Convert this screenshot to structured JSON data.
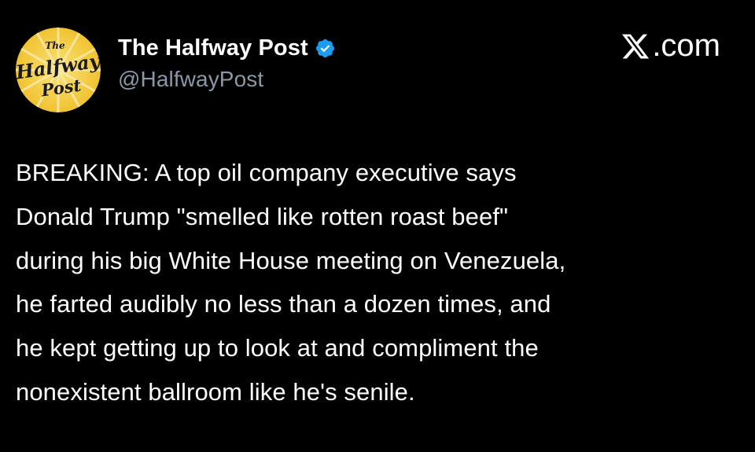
{
  "header": {
    "avatar_icon": "halfway-post-logo",
    "avatar_text_top": "The",
    "avatar_text_main": "Halfway",
    "avatar_text_bottom": "Post",
    "display_name": "The Halfway Post",
    "verified_icon": "verified-badge-icon",
    "handle": "@HalfwayPost",
    "brand_label": ".com",
    "brand_icon": "x-logo-icon"
  },
  "post": {
    "text": "BREAKING: A top oil company executive says\nDonald Trump \"smelled like rotten roast beef\"\nduring his big White House meeting on Venezuela,\nhe farted audibly no less than a dozen times, and\nhe kept getting up to look at and compliment the\nnonexistent ballroom like he's senile."
  },
  "colors": {
    "background": "#000000",
    "text": "#ffffff",
    "handle": "#8b98a5",
    "verified": "#1d9bf0",
    "avatar_bg": "#f6d34a"
  }
}
